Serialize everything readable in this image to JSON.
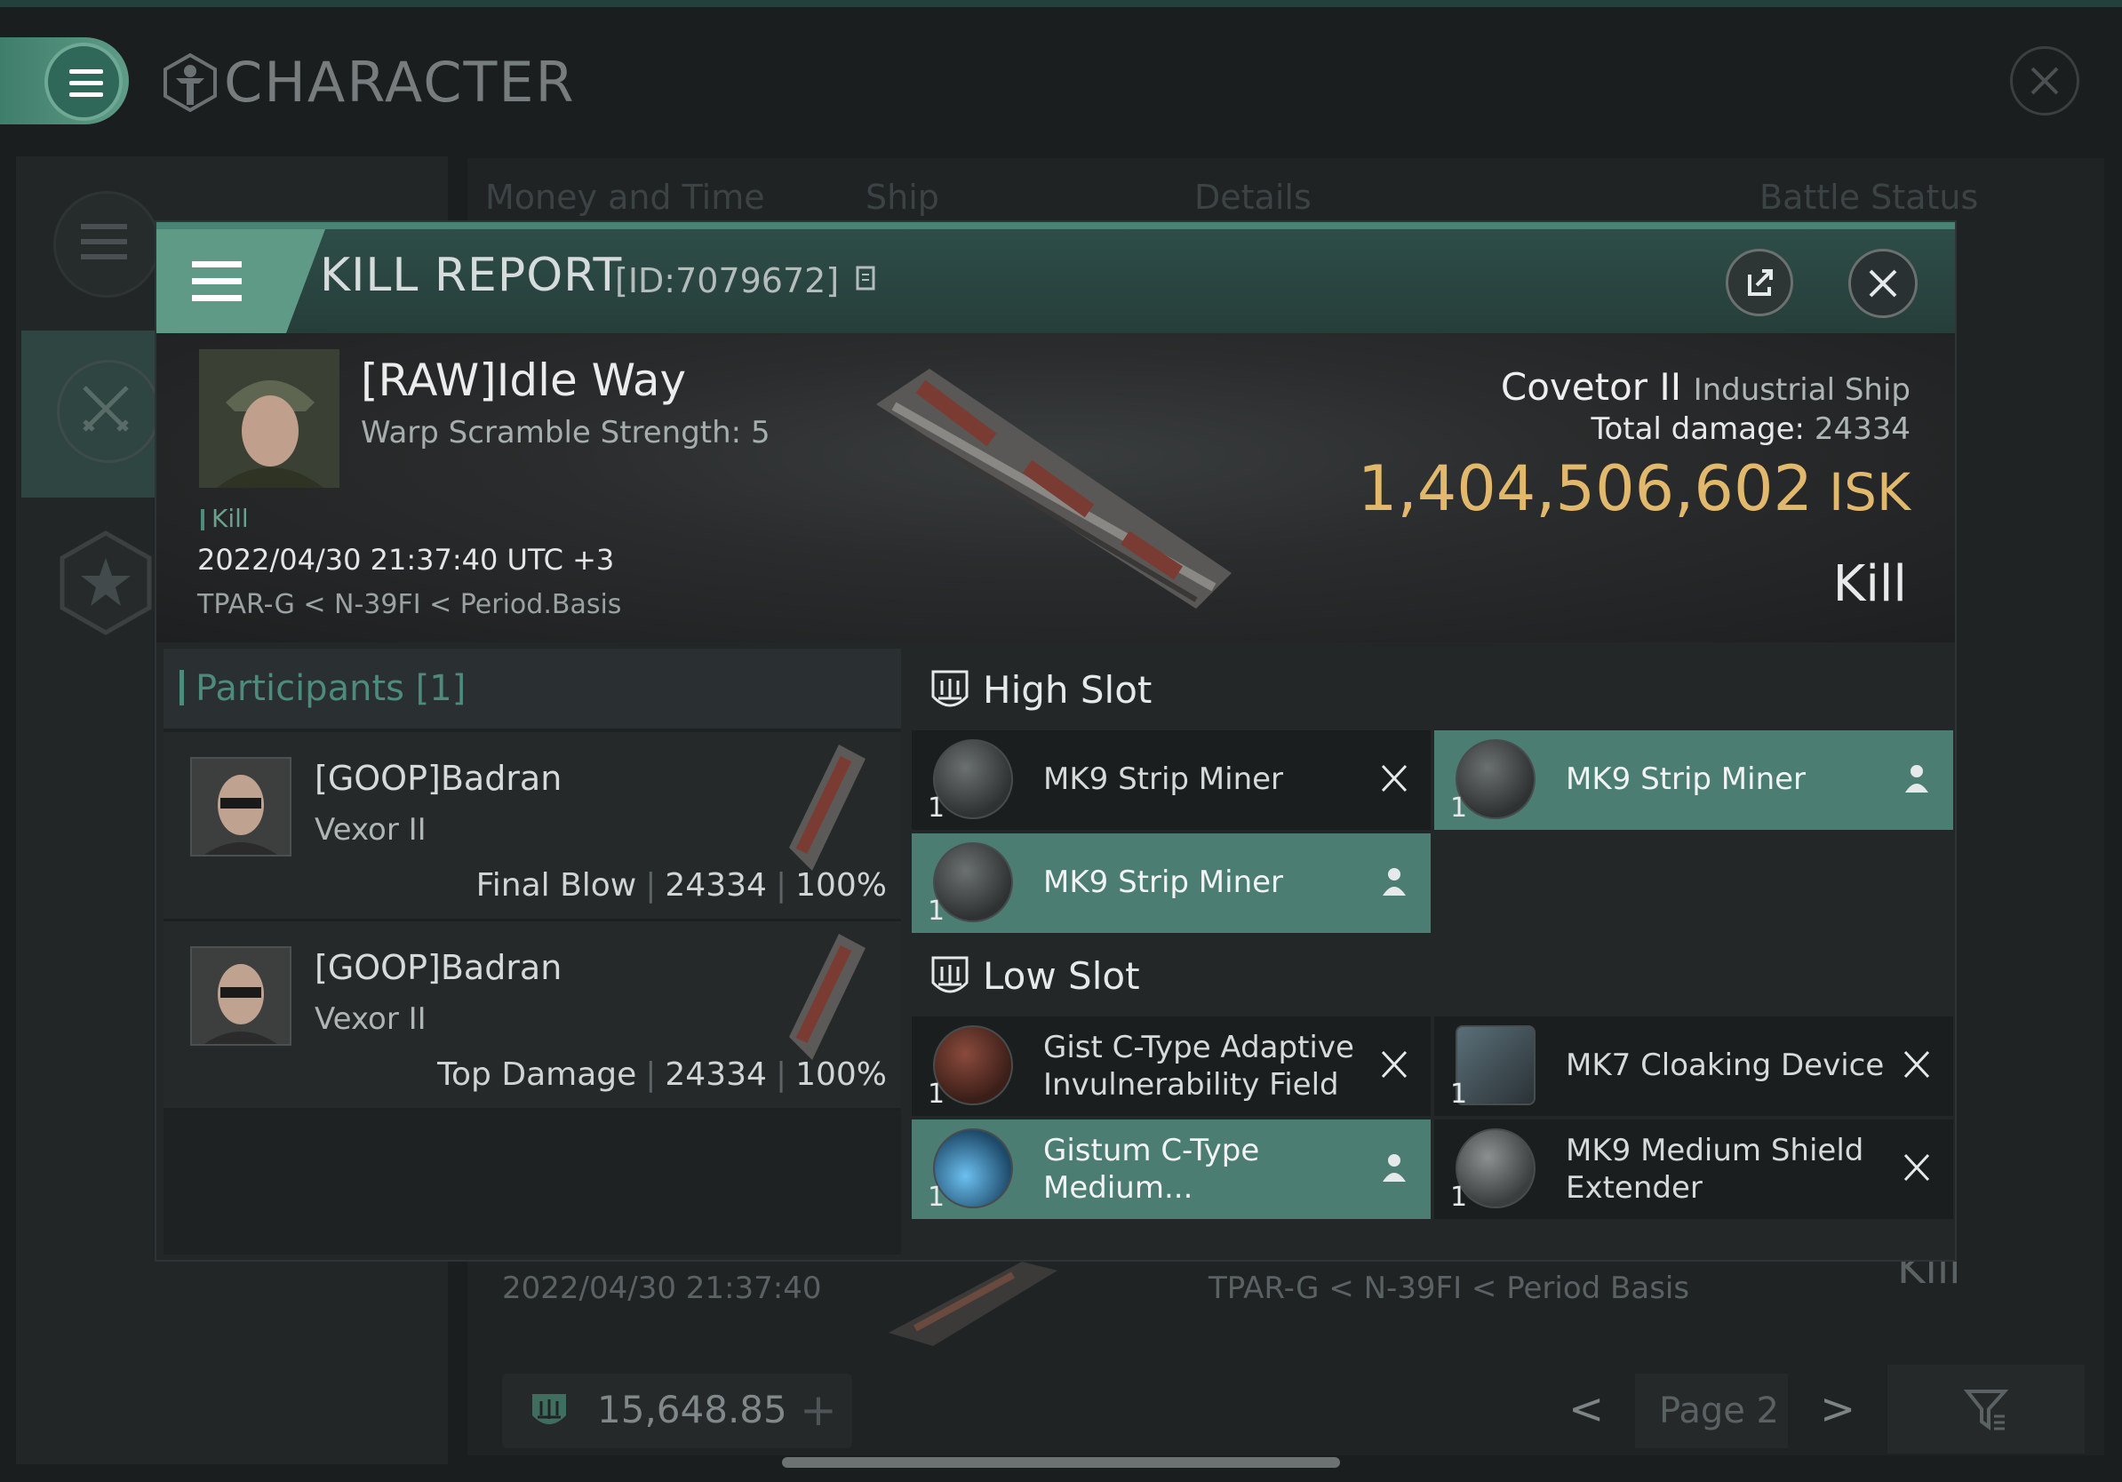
{
  "window": {
    "title": "CHARACTER"
  },
  "background_list": {
    "headers": [
      "Money and Time",
      "Ship",
      "Details",
      "Battle Status"
    ],
    "row": {
      "date": "2022/04/30  21:37:40",
      "location": "TPAR-G < N-39FI < Period Basis",
      "result": "Kill"
    },
    "wallet": "15,648.85",
    "wallet_add": "+",
    "prev": "<",
    "page": "Page 2",
    "next": ">"
  },
  "modal": {
    "title": "KILL REPORT",
    "id": "[ID:7079672]",
    "victim": {
      "name": "[RAW]Idle Way",
      "warp": "Warp Scramble Strength: 5",
      "tag": "Kill",
      "time": "2022/04/30 21:37:40 UTC +3",
      "location": "TPAR-G < N-39FI < Period.Basis"
    },
    "ship": {
      "name": "Covetor II",
      "class": "Industrial Ship",
      "damage_label": "Total damage:",
      "damage_value": "24334",
      "isk_value": "1,404,506,602",
      "isk_unit": "ISK",
      "result": "Kill"
    },
    "participants": {
      "title": "Participants [1]",
      "rows": [
        {
          "name": "[GOOP]Badran",
          "ship": "Vexor II",
          "role": "Final Blow",
          "damage": "24334",
          "percent": "100%"
        },
        {
          "name": "[GOOP]Badran",
          "ship": "Vexor II",
          "role": "Top Damage",
          "damage": "24334",
          "percent": "100%"
        }
      ]
    },
    "high_slot": {
      "title": "High Slot",
      "items": [
        {
          "qty": "1",
          "name": "MK9 Strip Miner",
          "state": "destroyed"
        },
        {
          "qty": "1",
          "name": "MK9 Strip Miner",
          "state": "dropped"
        },
        {
          "qty": "1",
          "name": "MK9 Strip Miner",
          "state": "dropped"
        }
      ]
    },
    "low_slot": {
      "title": "Low Slot",
      "items": [
        {
          "qty": "1",
          "name": "Gist C-Type Adaptive Invulnerability Field",
          "state": "destroyed"
        },
        {
          "qty": "1",
          "name": "MK7 Cloaking Device",
          "state": "destroyed"
        },
        {
          "qty": "1",
          "name": "Gistum C-Type Medium...",
          "state": "dropped"
        },
        {
          "qty": "1",
          "name": "MK9 Medium Shield Extender",
          "state": "destroyed"
        }
      ]
    }
  },
  "colors": {
    "accent": "#5e9a86",
    "isk": "#e2b86c",
    "highlight": "#4c7d73"
  }
}
